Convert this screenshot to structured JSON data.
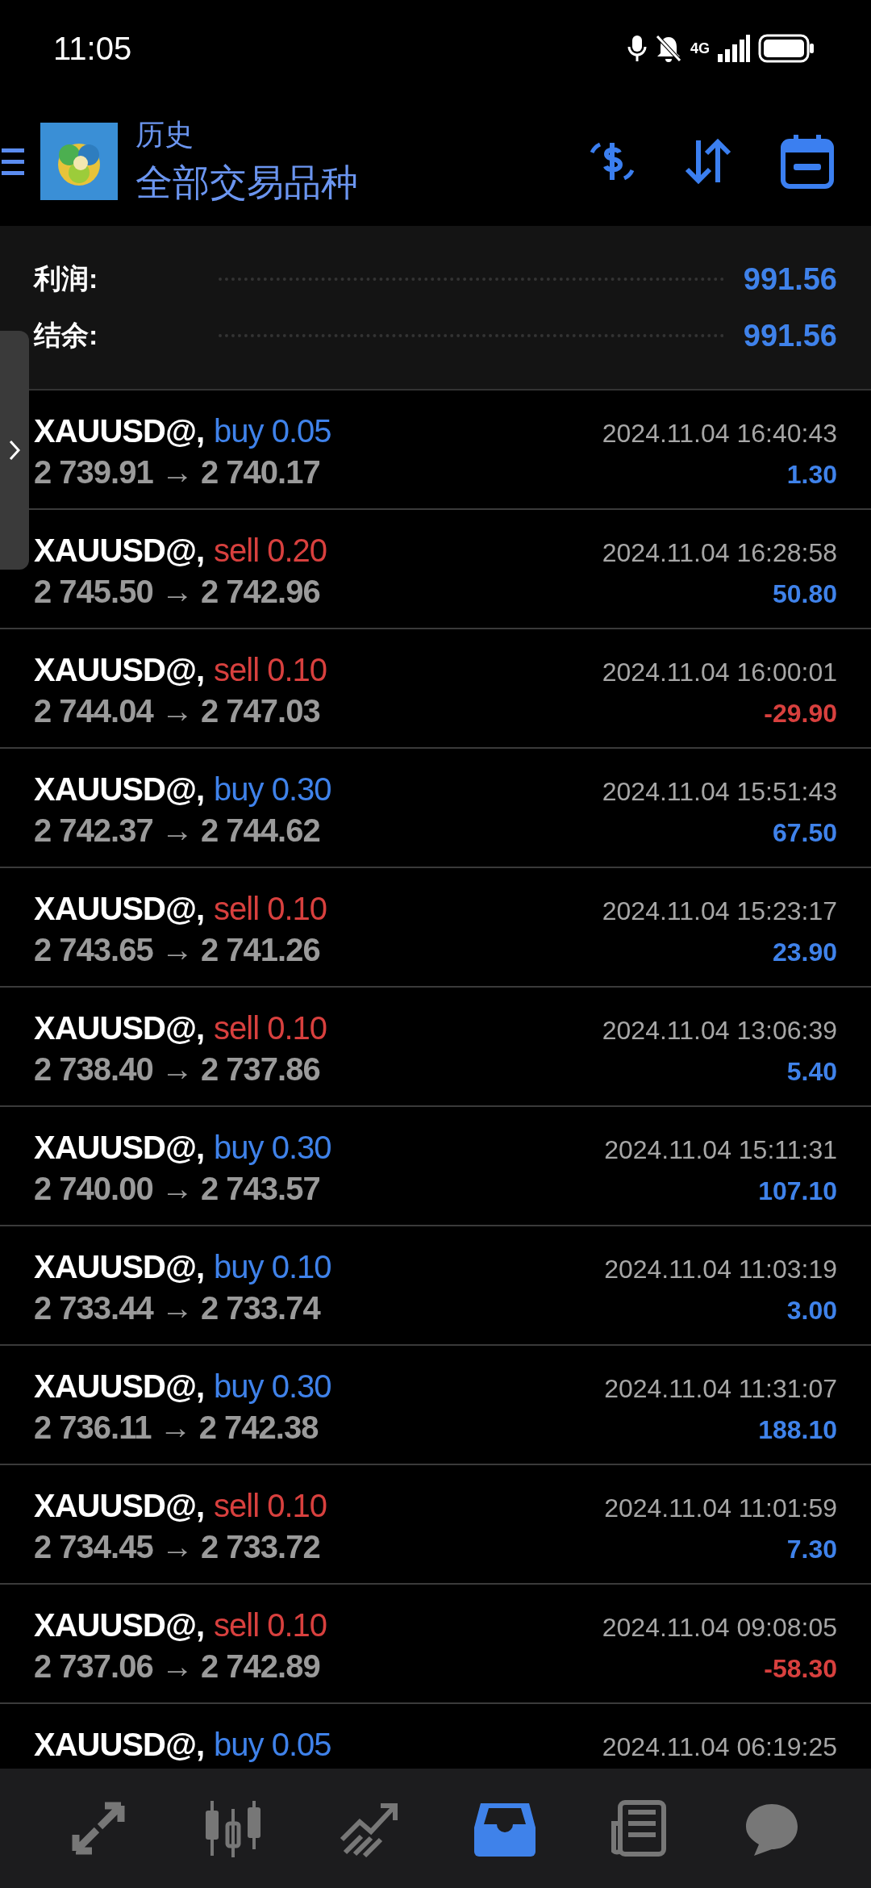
{
  "status_bar": {
    "time": "11:05",
    "network": "4G"
  },
  "header": {
    "title": "历史",
    "subtitle": "全部交易品种"
  },
  "summary": [
    {
      "label": "利润:",
      "value": "991.56"
    },
    {
      "label": "结余:",
      "value": "991.56"
    }
  ],
  "trades": [
    {
      "symbol": "XAUUSD@,",
      "order": {
        "text": "buy 0.05",
        "color": "#3f82ea"
      },
      "prices": "2 739.91 → 2 740.17",
      "time": "2024.11.04 16:40:43",
      "profit": {
        "text": "1.30",
        "color": "#3f82ea"
      }
    },
    {
      "symbol": "XAUUSD@,",
      "order": {
        "text": "sell 0.20",
        "color": "#d8403e"
      },
      "prices": "2 745.50 → 2 742.96",
      "time": "2024.11.04 16:28:58",
      "profit": {
        "text": "50.80",
        "color": "#3f82ea"
      }
    },
    {
      "symbol": "XAUUSD@,",
      "order": {
        "text": "sell 0.10",
        "color": "#d8403e"
      },
      "prices": "2 744.04 → 2 747.03",
      "time": "2024.11.04 16:00:01",
      "profit": {
        "text": "-29.90",
        "color": "#d8403e"
      }
    },
    {
      "symbol": "XAUUSD@,",
      "order": {
        "text": "buy 0.30",
        "color": "#3f82ea"
      },
      "prices": "2 742.37 → 2 744.62",
      "time": "2024.11.04 15:51:43",
      "profit": {
        "text": "67.50",
        "color": "#3f82ea"
      }
    },
    {
      "symbol": "XAUUSD@,",
      "order": {
        "text": "sell 0.10",
        "color": "#d8403e"
      },
      "prices": "2 743.65 → 2 741.26",
      "time": "2024.11.04 15:23:17",
      "profit": {
        "text": "23.90",
        "color": "#3f82ea"
      }
    },
    {
      "symbol": "XAUUSD@,",
      "order": {
        "text": "sell 0.10",
        "color": "#d8403e"
      },
      "prices": "2 738.40 → 2 737.86",
      "time": "2024.11.04 13:06:39",
      "profit": {
        "text": "5.40",
        "color": "#3f82ea"
      }
    },
    {
      "symbol": "XAUUSD@,",
      "order": {
        "text": "buy 0.30",
        "color": "#3f82ea"
      },
      "prices": "2 740.00 → 2 743.57",
      "time": "2024.11.04 15:11:31",
      "profit": {
        "text": "107.10",
        "color": "#3f82ea"
      }
    },
    {
      "symbol": "XAUUSD@,",
      "order": {
        "text": "buy 0.10",
        "color": "#3f82ea"
      },
      "prices": "2 733.44 → 2 733.74",
      "time": "2024.11.04 11:03:19",
      "profit": {
        "text": "3.00",
        "color": "#3f82ea"
      }
    },
    {
      "symbol": "XAUUSD@,",
      "order": {
        "text": "buy 0.30",
        "color": "#3f82ea"
      },
      "prices": "2 736.11 → 2 742.38",
      "time": "2024.11.04 11:31:07",
      "profit": {
        "text": "188.10",
        "color": "#3f82ea"
      }
    },
    {
      "symbol": "XAUUSD@,",
      "order": {
        "text": "sell 0.10",
        "color": "#d8403e"
      },
      "prices": "2 734.45 → 2 733.72",
      "time": "2024.11.04 11:01:59",
      "profit": {
        "text": "7.30",
        "color": "#3f82ea"
      }
    },
    {
      "symbol": "XAUUSD@,",
      "order": {
        "text": "sell 0.10",
        "color": "#d8403e"
      },
      "prices": "2 737.06 → 2 742.89",
      "time": "2024.11.04 09:08:05",
      "profit": {
        "text": "-58.30",
        "color": "#d8403e"
      }
    },
    {
      "symbol": "XAUUSD@,",
      "order": {
        "text": "buy 0.05",
        "color": "#3f82ea"
      },
      "time": "2024.11.04 06:19:25"
    }
  ],
  "nav": [
    {
      "kind": "trade",
      "selected": false
    },
    {
      "kind": "quotes",
      "selected": false
    },
    {
      "kind": "chart",
      "selected": false
    },
    {
      "kind": "history",
      "selected": true
    },
    {
      "kind": "news",
      "selected": false
    },
    {
      "kind": "chat",
      "selected": false
    }
  ]
}
